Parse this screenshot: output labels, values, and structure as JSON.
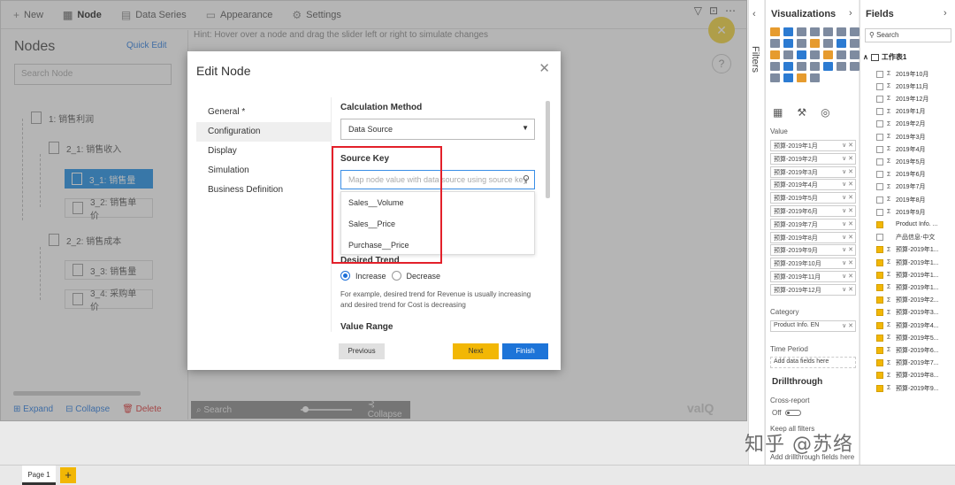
{
  "toolbar": {
    "tabs": [
      {
        "icon": "plus-icon",
        "label": "New"
      },
      {
        "icon": "node-icon",
        "label": "Node"
      },
      {
        "icon": "data-series-icon",
        "label": "Data Series"
      },
      {
        "icon": "appearance-icon",
        "label": "Appearance"
      },
      {
        "icon": "settings-icon",
        "label": "Settings"
      }
    ],
    "window_icons": [
      "filter-icon",
      "focus-icon",
      "more-icon"
    ]
  },
  "nodes_panel": {
    "title": "Nodes",
    "quick_edit": "Quick Edit",
    "search_placeholder": "Search Node",
    "tree": [
      {
        "label": "1: 销售利润"
      },
      {
        "label": "2_1: 销售收入"
      },
      {
        "label": "3_1: 销售量"
      },
      {
        "label": "3_2: 销售单价"
      },
      {
        "label": "2_2: 销售成本"
      },
      {
        "label": "3_3: 销售量"
      },
      {
        "label": "3_4: 采购单价"
      }
    ],
    "actions": {
      "expand": "Expand",
      "collapse": "Collapse",
      "delete": "Delete"
    }
  },
  "canvas": {
    "hint": "Hint: Hover over a node and drag the slider left or right to simulate changes",
    "search_placeholder": "Search",
    "collapse": "Collapse",
    "logo": "valQ"
  },
  "modal": {
    "title": "Edit Node",
    "nav": [
      "General *",
      "Configuration",
      "Display",
      "Simulation",
      "Business Definition"
    ],
    "active_nav": "Configuration",
    "calc_label": "Calculation Method",
    "calc_value": "Data Source",
    "source_key_label": "Source Key",
    "source_key_placeholder": "Map node value with data source using source key",
    "dropdown_options": [
      "Sales__Volume",
      "Sales__Price",
      "Purchase__Price"
    ],
    "desired_trend_label": "Desired Trend",
    "trend_options": [
      "Increase",
      "Decrease"
    ],
    "trend_selected": "Increase",
    "help_text": "For example, desired trend for Revenue is usually increasing and desired trend for Cost is decreasing",
    "value_range_label": "Value Range",
    "buttons": {
      "previous": "Previous",
      "next": "Next",
      "finish": "Finish"
    }
  },
  "filters_pane": {
    "label": "Filters"
  },
  "viz_pane": {
    "title": "Visualizations",
    "value_label": "Value",
    "value_items": [
      "预算-2019年1月",
      "预算-2019年2月",
      "预算-2019年3月",
      "预算-2019年4月",
      "预算-2019年5月",
      "预算-2019年6月",
      "预算-2019年7月",
      "预算-2019年8月",
      "预算-2019年9月",
      "预算-2019年10月",
      "预算-2019年11月",
      "预算-2019年12月"
    ],
    "category_label": "Category",
    "category_item": "Product Info. EN",
    "time_period_label": "Time Period",
    "time_period_placeholder": "Add data fields here",
    "drillthrough_label": "Drillthrough",
    "cross_report_label": "Cross-report",
    "cross_report_value": "Off",
    "keep_filters_label": "Keep all filters",
    "drill_placeholder": "Add drillthrough fields here"
  },
  "fields_pane": {
    "title": "Fields",
    "search_placeholder": "Search",
    "table_name": "工作表1",
    "fields": [
      {
        "label": "2019年10月",
        "checked": false,
        "sigma": true
      },
      {
        "label": "2019年11月",
        "checked": false,
        "sigma": true
      },
      {
        "label": "2019年12月",
        "checked": false,
        "sigma": true
      },
      {
        "label": "2019年1月",
        "checked": false,
        "sigma": true
      },
      {
        "label": "2019年2月",
        "checked": false,
        "sigma": true
      },
      {
        "label": "2019年3月",
        "checked": false,
        "sigma": true
      },
      {
        "label": "2019年4月",
        "checked": false,
        "sigma": true
      },
      {
        "label": "2019年5月",
        "checked": false,
        "sigma": true
      },
      {
        "label": "2019年6月",
        "checked": false,
        "sigma": true
      },
      {
        "label": "2019年7月",
        "checked": false,
        "sigma": true
      },
      {
        "label": "2019年8月",
        "checked": false,
        "sigma": true
      },
      {
        "label": "2019年9月",
        "checked": false,
        "sigma": true
      },
      {
        "label": "Product Info. ...",
        "checked": true,
        "sigma": false
      },
      {
        "label": "产品信息-中文",
        "checked": false,
        "sigma": false
      },
      {
        "label": "预算-2019年1...",
        "checked": true,
        "sigma": true
      },
      {
        "label": "预算-2019年1...",
        "checked": true,
        "sigma": true
      },
      {
        "label": "预算-2019年1...",
        "checked": true,
        "sigma": true
      },
      {
        "label": "预算-2019年1...",
        "checked": true,
        "sigma": true
      },
      {
        "label": "预算-2019年2...",
        "checked": true,
        "sigma": true
      },
      {
        "label": "预算-2019年3...",
        "checked": true,
        "sigma": true
      },
      {
        "label": "预算-2019年4...",
        "checked": true,
        "sigma": true
      },
      {
        "label": "预算-2019年5...",
        "checked": true,
        "sigma": true
      },
      {
        "label": "预算-2019年6...",
        "checked": true,
        "sigma": true
      },
      {
        "label": "预算-2019年7...",
        "checked": true,
        "sigma": true
      },
      {
        "label": "预算-2019年8...",
        "checked": true,
        "sigma": true
      },
      {
        "label": "预算-2019年9...",
        "checked": true,
        "sigma": true
      }
    ]
  },
  "footer": {
    "page_tab": "Page 1",
    "add_page": "+"
  },
  "watermark": "知乎 @苏络",
  "colors": {
    "accent_blue": "#1d74d8",
    "accent_yellow": "#f2b705",
    "highlight_red": "#e3202a"
  }
}
